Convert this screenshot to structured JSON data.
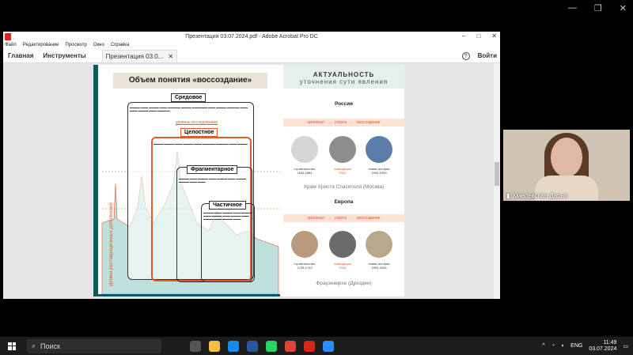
{
  "window": {
    "title": "Презентация 03.07.2024.pdf - Adobe Acrobat Pro DC"
  },
  "menu": [
    "Файл",
    "Редактирование",
    "Просмотр",
    "Окно",
    "Справка"
  ],
  "tabs": {
    "home": "Главная",
    "tools": "Инструменты",
    "doc": "Презентация 03.0...",
    "signin": "Войти"
  },
  "slide": {
    "left_title": "Объем понятия «воссоздание»",
    "levels": [
      "Средовое",
      "Целостное",
      "Фрагментарное",
      "Частичное"
    ],
    "research_level": "уровень исследования",
    "vertical_label": "уровни реставрационных дополнений",
    "right_title": "АКТУАЛЬНОСТЬ",
    "right_subtitle": "уточнения сути явления",
    "russia": "Россия",
    "europe": "Европа",
    "arrows": [
      "оригинал",
      "утрата",
      "воссоздание"
    ],
    "russia_caps": [
      {
        "a": "строительство",
        "b": "1839-1881"
      },
      {
        "a": "ликвидация",
        "b": "1931"
      },
      {
        "a": "новая история",
        "b": "1994-1999"
      }
    ],
    "russia_name": "Храм Христа Спасителя (Москва)",
    "europe_caps": [
      {
        "a": "строительство",
        "b": "1726-1743"
      },
      {
        "a": "ликвидация",
        "b": "1945"
      },
      {
        "a": "новая история",
        "b": "1993-2005"
      }
    ],
    "europe_name": "Фрауэнкирхе (Дрезден)"
  },
  "participant": {
    "name": "Хмелевская Дарья"
  },
  "taskbar": {
    "search": "Поиск",
    "lang": "ENG",
    "time": "11:49",
    "date": "03.07.2024"
  }
}
